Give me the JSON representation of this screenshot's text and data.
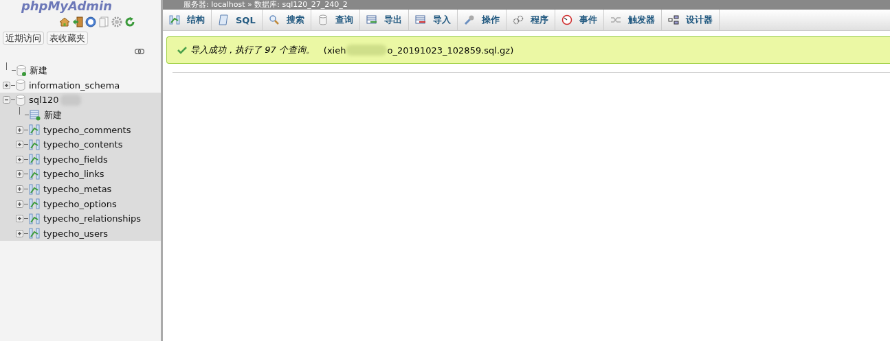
{
  "sidebar": {
    "logo": "phpMyAdmin",
    "buttons": [
      "近期访问",
      "表收藏夹"
    ],
    "tree": [
      {
        "kind": "new",
        "label": "新建"
      },
      {
        "kind": "db",
        "label": "information_schema",
        "expanded": false,
        "selected": false
      },
      {
        "kind": "db",
        "label": "sql120",
        "expanded": true,
        "selected": true,
        "children": [
          {
            "kind": "new",
            "label": "新建"
          },
          {
            "kind": "table",
            "label": "typecho_comments",
            "expanded": false
          },
          {
            "kind": "table",
            "label": "typecho_contents",
            "expanded": false
          },
          {
            "kind": "table",
            "label": "typecho_fields",
            "expanded": false
          },
          {
            "kind": "table",
            "label": "typecho_links",
            "expanded": false
          },
          {
            "kind": "table",
            "label": "typecho_metas",
            "expanded": false
          },
          {
            "kind": "table",
            "label": "typecho_options",
            "expanded": false
          },
          {
            "kind": "table",
            "label": "typecho_relationships",
            "expanded": false
          },
          {
            "kind": "table",
            "label": "typecho_users",
            "expanded": false
          }
        ]
      }
    ]
  },
  "breadcrumb": "服务器: localhost » 数据库: sql120_27_240_2",
  "tabs": [
    "结构",
    "SQL",
    "搜索",
    "查询",
    "导出",
    "导入",
    "操作",
    "程序",
    "事件",
    "触发器",
    "设计器"
  ],
  "message": {
    "text": "导入成功，执行了 97 个查询。",
    "file_start": "(xieh",
    "file_end": "o_20191023_102859.sql.gz)"
  }
}
